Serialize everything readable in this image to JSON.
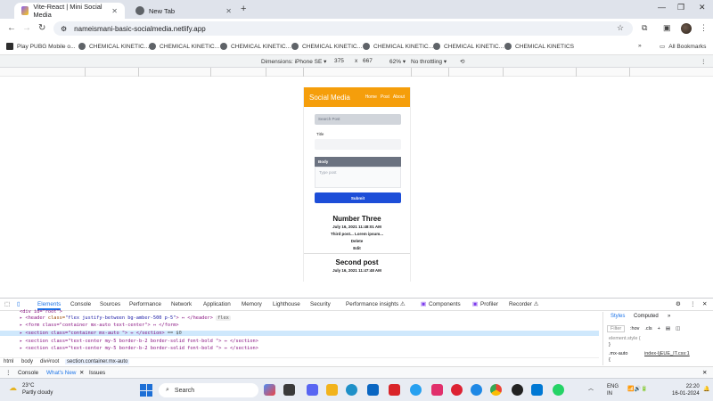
{
  "browser": {
    "tabs": [
      {
        "title": "Vite-React | Mini Social Media",
        "close": "✕"
      },
      {
        "title": "New Tab",
        "close": "✕"
      }
    ],
    "new_tab": "+",
    "window_controls": {
      "minimize": "—",
      "restore": "❐",
      "close": "✕"
    },
    "url": "nameismani-basic-socialmedia.netlify.app",
    "bookmarks": [
      "Play PUBG Mobile o...",
      "CHEMICAL KINETIC...",
      "CHEMICAL KINETIC...",
      "CHEMICAL KINETIC...",
      "CHEMICAL KINETIC...",
      "CHEMICAL KINETIC...",
      "CHEMICAL KINETIC...",
      "CHEMICAL KINETICS"
    ],
    "all_bookmarks": "All Bookmarks",
    "more": "»"
  },
  "device_toolbar": {
    "dimensions": "Dimensions: iPhone SE ▾",
    "width": "375",
    "x": "x",
    "height": "667",
    "zoom": "62% ▾",
    "throttling": "No throttling ▾"
  },
  "app": {
    "title": "Social Media",
    "nav": [
      "Home",
      "Post",
      "About"
    ],
    "search_placeholder": "Search Post",
    "title_label": "Title",
    "body_label": "Body",
    "body_placeholder": "Type post",
    "submit": "Submit",
    "posts": [
      {
        "title": "Number Three",
        "date": "July 16, 2021 11:48:01 AM",
        "body": "Third post... Lorem ipsum...",
        "delete": "Delete",
        "edit": "Edit"
      },
      {
        "title": "Second post",
        "date": "July 16, 2021 11:47:48 AM"
      }
    ]
  },
  "devtools": {
    "tabs": [
      "Elements",
      "Console",
      "Sources",
      "Performance",
      "Network",
      "Application",
      "Memory",
      "Lighthouse",
      "Security",
      "Performance insights ⚠",
      "Components",
      "Profiler",
      "Recorder ⚠"
    ],
    "elements": {
      "line0": "<div id=\"root\">",
      "line1_tag": "<header",
      "line1_attr": "class=",
      "line1_val": "\"flex justify-between  bg-amber-500 p-5\"",
      "line1_rest": "> ↔ </header>",
      "line1_badge": "flex",
      "line2": "<form class=\"container mx-auto text-center\"> ↔ </form>",
      "line3": "<section class=\"container mx-auto \"> ↔ </section>",
      "line3_eq": "== $0",
      "line4": "<section class=\"text-center my-5 border-b-2 border-solid font-bold \"> ↔ </section>",
      "line5": "<section class=\"text-center my-5 border-b-2 border-solid font-bold \"> ↔ </section>"
    },
    "styles_tabs": [
      "Styles",
      "Computed",
      "»"
    ],
    "filter": "Filter",
    "hov": ":hov",
    "cls": ".cls",
    "rule1": "element.style {",
    "rule1_close": "}",
    "rule2_sel": ".mx-auto",
    "rule2_src": "index-IjEUE_IT.css:1",
    "rule2_brace": "{",
    "crumbs": [
      "html",
      "body",
      "div#root",
      "section.container.mx-auto"
    ],
    "drawer": [
      "Console",
      "What's New",
      "Issues"
    ]
  },
  "taskbar": {
    "temp": "23°C",
    "weather": "Partly cloudy",
    "search": "Search",
    "lang": "ENG",
    "region": "IN",
    "time": "22:20",
    "date": "16-01-2024"
  }
}
